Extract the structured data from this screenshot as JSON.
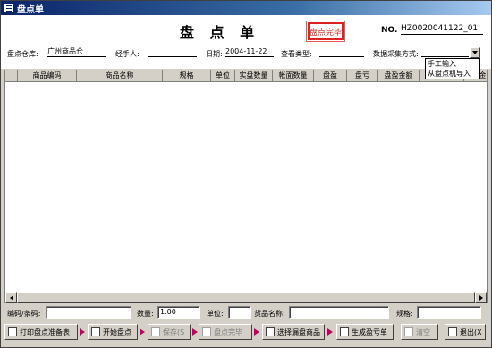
{
  "window": {
    "title": "盘点单"
  },
  "header": {
    "title": "盘 点 单",
    "stamp": "盘点完毕",
    "no_label": "NO.",
    "no_value": "HZ0020041122_01"
  },
  "form": {
    "warehouse_label": "盘点仓库:",
    "warehouse_value": "广州商品仓",
    "handler_label": "经手人:",
    "handler_value": "",
    "date_label": "日期:",
    "date_value": "2004-11-22",
    "check_type_label": "查看类型:",
    "check_type_value": "",
    "collect_label": "数据采集方式:",
    "collect_value": "",
    "collect_options": [
      "手工输入",
      "从盘点机导入"
    ]
  },
  "grid": {
    "columns": [
      "",
      "商品编码",
      "商品名称",
      "规格",
      "单位",
      "实盘数量",
      "帐面数量",
      "盘盈",
      "盘亏",
      "盘盈金额",
      "",
      "盘亏金"
    ]
  },
  "bottom": {
    "barcode_label": "编码/条码:",
    "barcode_value": "",
    "qty_label": "数量:",
    "qty_value": "1.00",
    "unit_label": "单位:",
    "unit_value": "",
    "goods_label": "货品名称:",
    "goods_value": "",
    "spec_label": "规格:",
    "spec_value": ""
  },
  "toolbar": {
    "print": "打印盘点准备表",
    "start": "开始盘点",
    "save": "保存(S",
    "finish": "盘点完毕",
    "select_missing": "选择漏盘商品",
    "generate": "生成盈亏单",
    "clear": "清空",
    "exit": "退出(X"
  },
  "colors": {
    "title_bar": "#0a246a",
    "stamp": "#dd2222",
    "arrow": "#c00060"
  }
}
